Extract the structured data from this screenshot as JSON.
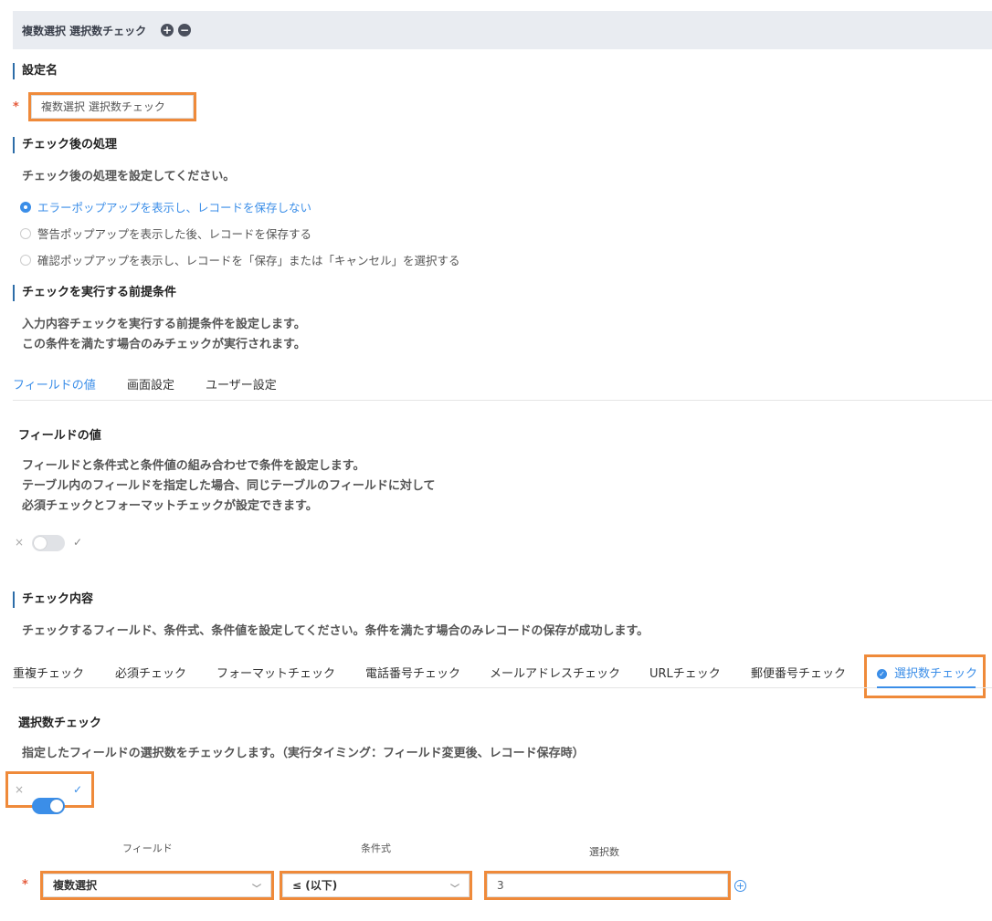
{
  "header": {
    "title": "複数選択 選択数チェック",
    "add_icon": "plus-circle-icon",
    "remove_icon": "minus-circle-icon"
  },
  "setting_name": {
    "label": "設定名",
    "value": "複数選択 選択数チェック"
  },
  "after_check": {
    "label": "チェック後の処理",
    "description": "チェック後の処理を設定してください。",
    "options": [
      {
        "label": "エラーポップアップを表示し、レコードを保存しない",
        "selected": true
      },
      {
        "label": "警告ポップアップを表示した後、レコードを保存する",
        "selected": false
      },
      {
        "label": "確認ポップアップを表示し、レコードを「保存」または「キャンセル」を選択する",
        "selected": false
      }
    ]
  },
  "precondition": {
    "label": "チェックを実行する前提条件",
    "description_line1": "入力内容チェックを実行する前提条件を設定します。",
    "description_line2": "この条件を満たす場合のみチェックが実行されます。",
    "tabs": [
      "フィールドの値",
      "画面設定",
      "ユーザー設定"
    ],
    "active_tab": 0,
    "field_value": {
      "title": "フィールドの値",
      "line1": "フィールドと条件式と条件値の組み合わせで条件を設定します。",
      "line2": "テーブル内のフィールドを指定した場合、同じテーブルのフィールドに対して",
      "line3": "必須チェックとフォーマットチェックが設定できます。",
      "toggle_on": false
    }
  },
  "check_content": {
    "label": "チェック内容",
    "description": "チェックするフィールド、条件式、条件値を設定してください。条件を満たす場合のみレコードの保存が成功します。",
    "tabs": [
      "重複チェック",
      "必須チェック",
      "フォーマットチェック",
      "電話番号チェック",
      "メールアドレスチェック",
      "URLチェック",
      "郵便番号チェック",
      "選択数チェック"
    ],
    "active_tab": 7,
    "selection_count": {
      "title": "選択数チェック",
      "description": "指定したフィールドの選択数をチェックします。（実行タイミング：フィールド変更後、レコード保存時）",
      "toggle_on": true,
      "col_field": "フィールド",
      "col_condition": "条件式",
      "col_count": "選択数",
      "field_value": "複数選択",
      "condition_value": "≤ (以下)",
      "count_value": "3"
    }
  },
  "symbols": {
    "required": "*",
    "toggle_off": "×",
    "toggle_on": "✓",
    "chevron": "﹀",
    "plus": "+",
    "minus": "−"
  },
  "colors": {
    "accent": "#3b8ee8",
    "highlight": "#ef8a3a",
    "required": "#e55a3a",
    "section_bar": "#2d6da8"
  }
}
